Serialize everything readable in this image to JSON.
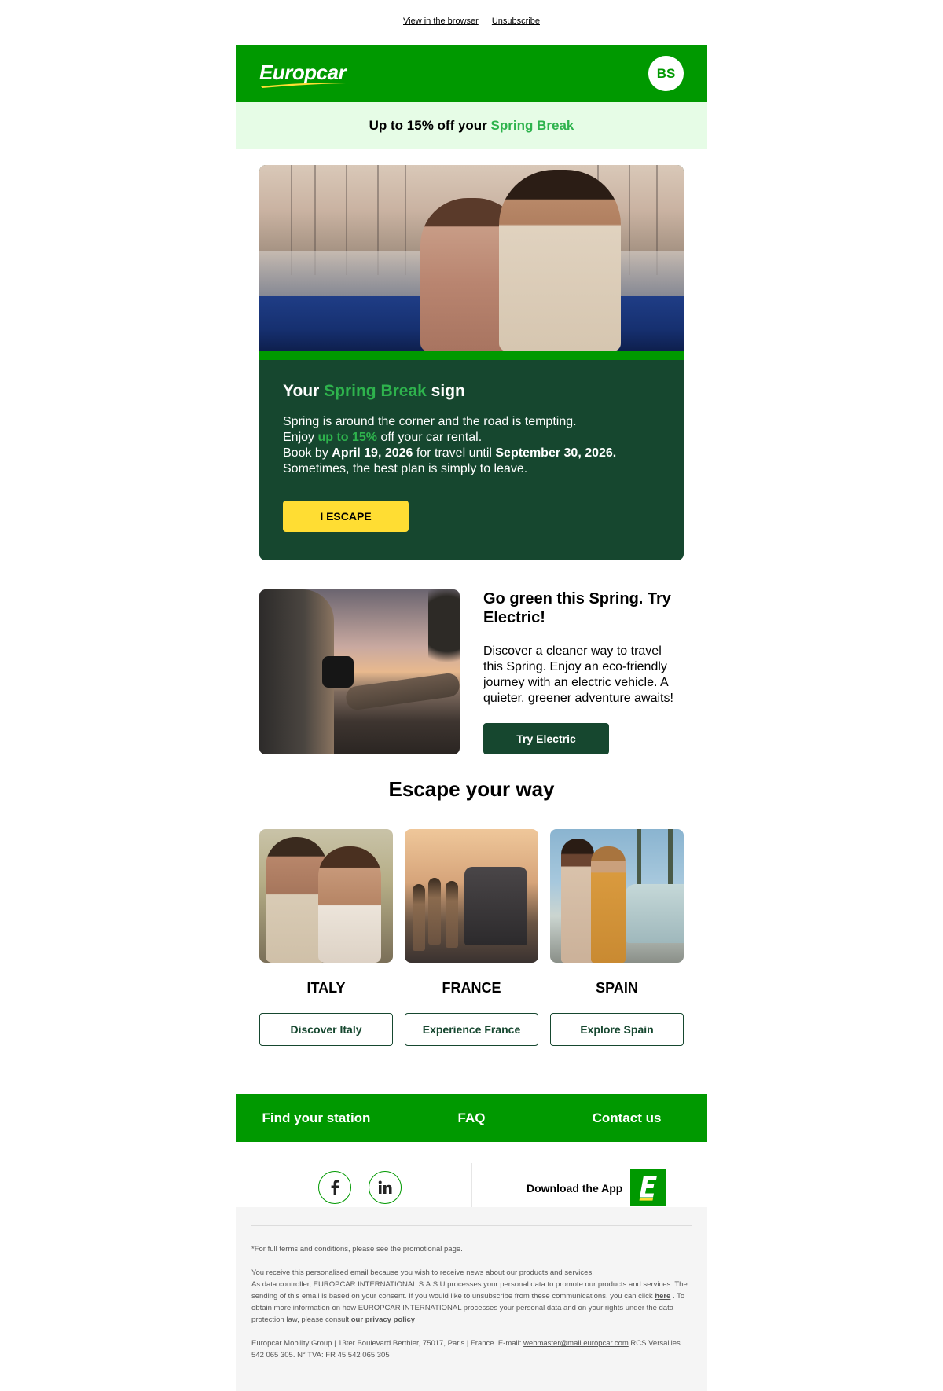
{
  "top_links": {
    "view_browser": "View in the browser",
    "unsubscribe": "Unsubscribe"
  },
  "header": {
    "logo": "Europcar",
    "avatar_initials": "BS"
  },
  "promo_bar": {
    "prefix": "Up to 15% off your ",
    "highlight": "Spring Break"
  },
  "hero": {
    "title_prefix": "Your ",
    "title_highlight": "Spring Break",
    "title_suffix": " sign",
    "line1": "Spring is around the corner and the road is tempting.",
    "line2_prefix": "Enjoy ",
    "line2_highlight": "up to 15%",
    "line2_suffix": " off your car rental.",
    "line3_prefix": "Book by ",
    "line3_date1": "April 19, 2026",
    "line3_mid": " for travel until ",
    "line3_date2": "September 30, 2026.",
    "line4": "Sometimes, the best plan is simply to leave.",
    "button": "I ESCAPE"
  },
  "electric": {
    "title": "Go green this Spring. Try Electric!",
    "body": "Discover a cleaner way to travel this Spring. Enjoy an eco-friendly journey with an electric vehicle. A quieter, greener adventure awaits!",
    "button": "Try Electric"
  },
  "escape": {
    "title": "Escape your way",
    "destinations": [
      {
        "name": "ITALY",
        "button": "Discover Italy"
      },
      {
        "name": "FRANCE",
        "button": "Experience France"
      },
      {
        "name": "SPAIN",
        "button": "Explore Spain"
      }
    ]
  },
  "navbar": {
    "items": [
      "Find your station",
      "FAQ",
      "Contact us"
    ]
  },
  "app": {
    "download_label": "Download the App"
  },
  "footer": {
    "terms": "*For full terms and conditions, please see the promotional page.",
    "consent_line1": "You receive this personalised email because you wish to receive news about our products and services.",
    "consent_line2a": "As data controller, EUROPCAR INTERNATIONAL S.A.S.U processes your personal data to promote our products and services. The sending of this email is based on your consent. If you would like to unsubscribe from these communications, you can click ",
    "consent_here": "here",
    "consent_line2b": " . To obtain more information on how EUROPCAR INTERNATIONAL processes your personal data and on your rights under the data protection law, please consult ",
    "privacy_link": "our privacy policy",
    "consent_end": ".",
    "address_prefix": "Europcar Mobility Group | 13ter Boulevard Berthier, 75017, Paris | France. E-mail: ",
    "email": "webmaster@mail.europcar.com",
    "address_suffix": " RCS Versailles 542 065 305. N° TVA: FR 45 542 065 305"
  },
  "colors": {
    "brand_green": "#009900",
    "dark_green": "#16472f",
    "highlight_green": "#2eb34d",
    "yellow": "#ffdd33",
    "promo_bg": "#e6fce6"
  },
  "icons": [
    "facebook-icon",
    "linkedin-icon",
    "europcar-app-icon"
  ]
}
